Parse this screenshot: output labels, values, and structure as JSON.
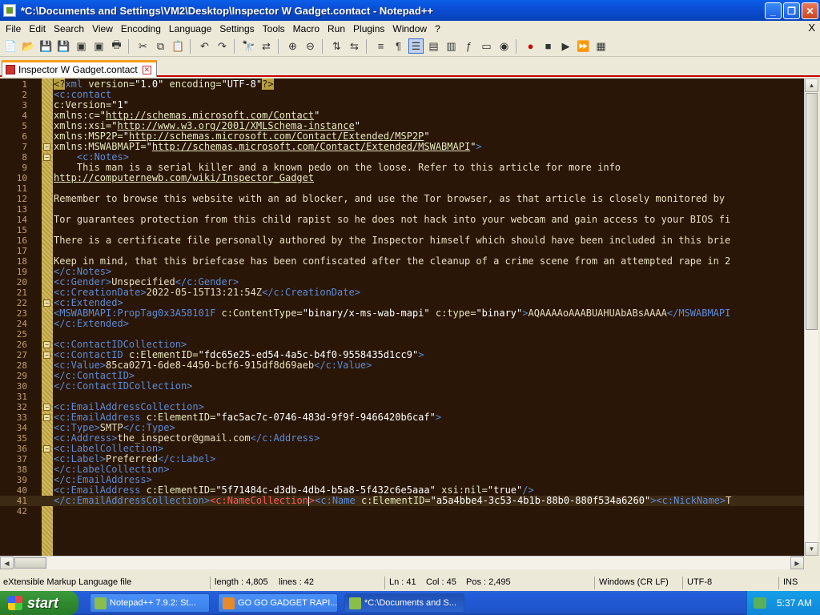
{
  "window": {
    "title": "*C:\\Documents and Settings\\VM2\\Desktop\\Inspector W Gadget.contact - Notepad++"
  },
  "menu": [
    "File",
    "Edit",
    "Search",
    "View",
    "Encoding",
    "Language",
    "Settings",
    "Tools",
    "Macro",
    "Run",
    "Plugins",
    "Window",
    "?"
  ],
  "menu_close": "X",
  "tab": {
    "label": "Inspector W Gadget.contact"
  },
  "code_lines": [
    {
      "n": "1",
      "fold": "",
      "html": "<span class=\"pi\">&lt;?</span><span class=\"t\">xml</span> <span class=\"a\">version=</span><span class=\"v\">\"1.0\"</span> <span class=\"a\">encoding=</span><span class=\"v\">\"UTF-8\"</span><span class=\"pi\">?&gt;</span>"
    },
    {
      "n": "2",
      "fold": "",
      "html": "<span class=\"t\">&lt;c:contact</span>"
    },
    {
      "n": "3",
      "fold": "",
      "html": "<span class=\"a\">c:Version=</span><span class=\"v\">\"1\"</span>"
    },
    {
      "n": "4",
      "fold": "",
      "html": "<span class=\"a\">xmlns:c=</span><span class=\"v\">\"<span class=\"l\">http://schemas.microsoft.com/Contact</span>\"</span>"
    },
    {
      "n": "5",
      "fold": "",
      "html": "<span class=\"a\">xmlns:xsi=</span><span class=\"v\">\"<span class=\"l\">http://www.w3.org/2001/XMLSchema-instance</span>\"</span>"
    },
    {
      "n": "6",
      "fold": "",
      "html": "<span class=\"a\">xmlns:MSP2P=</span><span class=\"v\">\"<span class=\"l\">http://schemas.microsoft.com/Contact/Extended/MSP2P</span>\"</span>"
    },
    {
      "n": "7",
      "fold": "-",
      "html": "<span class=\"a\">xmlns:MSWABMAPI=</span><span class=\"v\">\"<span class=\"l\">http://schemas.microsoft.com/Contact/Extended/MSWABMAPI</span>\"</span><span class=\"t\">&gt;</span>"
    },
    {
      "n": "8",
      "fold": "-",
      "html": "    <span class=\"t\">&lt;c:Notes&gt;</span>"
    },
    {
      "n": "9",
      "fold": "",
      "html": "<span class=\"txt\">    This man is a serial killer and a known pedo on the loose. Refer to this article for more info</span>"
    },
    {
      "n": "10",
      "fold": "",
      "html": "<span class=\"l\">http://computernewb.com/wiki/Inspector_Gadget</span>"
    },
    {
      "n": "11",
      "fold": "",
      "html": ""
    },
    {
      "n": "12",
      "fold": "",
      "html": "<span class=\"txt\">Remember to browse this website with an ad blocker, and use the Tor browser, as that article is closely monitored by</span>"
    },
    {
      "n": "13",
      "fold": "",
      "html": ""
    },
    {
      "n": "14",
      "fold": "",
      "html": "<span class=\"txt\">Tor guarantees protection from this child rapist so he does not hack into your webcam and gain access to your BIOS fi</span>"
    },
    {
      "n": "15",
      "fold": "",
      "html": ""
    },
    {
      "n": "16",
      "fold": "",
      "html": "<span class=\"txt\">There is a certificate file personally authored by the Inspector himself which should have been included in this brie</span>"
    },
    {
      "n": "17",
      "fold": "",
      "html": ""
    },
    {
      "n": "18",
      "fold": "",
      "html": "<span class=\"txt\">Keep in mind, that this briefcase has been confiscated after the cleanup of a crime scene from an attempted rape in 2</span>"
    },
    {
      "n": "19",
      "fold": "",
      "html": "<span class=\"t\">&lt;/c:Notes&gt;</span>"
    },
    {
      "n": "20",
      "fold": "",
      "html": "<span class=\"t\">&lt;c:Gender&gt;</span><span class=\"txt\">Unspecified</span><span class=\"t\">&lt;/c:Gender&gt;</span>"
    },
    {
      "n": "21",
      "fold": "",
      "html": "<span class=\"t\">&lt;c:CreationDate&gt;</span><span class=\"txt\">2022-05-15T13:21:54Z</span><span class=\"t\">&lt;/c:CreationDate&gt;</span>"
    },
    {
      "n": "22",
      "fold": "-",
      "html": "<span class=\"t\">&lt;c:Extended&gt;</span>"
    },
    {
      "n": "23",
      "fold": "",
      "html": "<span class=\"t\">&lt;MSWABMAPI:PropTag0x3A58101F</span> <span class=\"a\">c:ContentType=</span><span class=\"v\">\"binary/x-ms-wab-mapi\"</span> <span class=\"a\">c:type=</span><span class=\"v\">\"binary\"</span><span class=\"t\">&gt;</span><span class=\"txt\">AQAAAAoAAABUAHUAbABsAAAA</span><span class=\"t\">&lt;/MSWABMAPI</span>"
    },
    {
      "n": "24",
      "fold": "",
      "html": "<span class=\"t\">&lt;/c:Extended&gt;</span>"
    },
    {
      "n": "25",
      "fold": "",
      "html": ""
    },
    {
      "n": "26",
      "fold": "-",
      "html": "<span class=\"t\">&lt;c:ContactIDCollection&gt;</span>"
    },
    {
      "n": "27",
      "fold": "-",
      "html": "<span class=\"t\">&lt;c:ContactID</span> <span class=\"a\">c:ElementID=</span><span class=\"v\">\"fdc65e25-ed54-4a5c-b4f0-9558435d1cc9\"</span><span class=\"t\">&gt;</span>"
    },
    {
      "n": "28",
      "fold": "",
      "html": "<span class=\"t\">&lt;c:Value&gt;</span><span class=\"txt\">85ca0271-6de8-4450-bcf6-915df8d69aeb</span><span class=\"t\">&lt;/c:Value&gt;</span>"
    },
    {
      "n": "29",
      "fold": "",
      "html": "<span class=\"t\">&lt;/c:ContactID&gt;</span>"
    },
    {
      "n": "30",
      "fold": "",
      "html": "<span class=\"t\">&lt;/c:ContactIDCollection&gt;</span>"
    },
    {
      "n": "31",
      "fold": "",
      "html": ""
    },
    {
      "n": "32",
      "fold": "-",
      "html": "<span class=\"t\">&lt;c:EmailAddressCollection&gt;</span>"
    },
    {
      "n": "33",
      "fold": "-",
      "html": "<span class=\"t\">&lt;c:EmailAddress</span> <span class=\"a\">c:ElementID=</span><span class=\"v\">\"fac5ac7c-0746-483d-9f9f-9466420b6caf\"</span><span class=\"t\">&gt;</span>"
    },
    {
      "n": "34",
      "fold": "",
      "html": "<span class=\"t\">&lt;c:Type&gt;</span><span class=\"txt\">SMTP</span><span class=\"t\">&lt;/c:Type&gt;</span>"
    },
    {
      "n": "35",
      "fold": "",
      "html": "<span class=\"t\">&lt;c:Address&gt;</span><span class=\"txt\">the_inspector@gmail.com</span><span class=\"t\">&lt;/c:Address&gt;</span>"
    },
    {
      "n": "36",
      "fold": "-",
      "html": "<span class=\"t\">&lt;c:LabelCollection&gt;</span>"
    },
    {
      "n": "37",
      "fold": "",
      "html": "<span class=\"t\">&lt;c:Label&gt;</span><span class=\"txt\">Preferred</span><span class=\"t\">&lt;/c:Label&gt;</span>"
    },
    {
      "n": "38",
      "fold": "",
      "html": "<span class=\"t\">&lt;/c:LabelCollection&gt;</span>"
    },
    {
      "n": "39",
      "fold": "",
      "html": "<span class=\"t\">&lt;/c:EmailAddress&gt;</span>"
    },
    {
      "n": "40",
      "fold": "",
      "html": "<span class=\"t\">&lt;c:EmailAddress</span> <span class=\"a\">c:ElementID=</span><span class=\"v\">\"5f71484c-d3db-4db4-b5a8-5f432c6e5aaa\"</span> <span class=\"a\">xsi:nil=</span><span class=\"v\">\"true\"</span><span class=\"t\">/&gt;</span>"
    },
    {
      "n": "41",
      "fold": "",
      "html": "<span class=\"t\">&lt;/c:EmailAddressCollection&gt;</span><span class=\"nc\">&lt;c:NameCollection</span><span class=\"caret\"></span><span class=\"nc\">&gt;</span><span class=\"t\">&lt;c:Name</span> <span class=\"a\">c:ElementID=</span><span class=\"v\">\"a5a4bbe4-3c53-4b1b-88b0-880f534a6260\"</span><span class=\"t\">&gt;&lt;c:NickName&gt;</span><span class=\"txt\">T</span>"
    },
    {
      "n": "42",
      "fold": "",
      "html": ""
    }
  ],
  "status": {
    "filetype": "eXtensible Markup Language file",
    "length": "length : 4,805",
    "lines": "lines : 42",
    "ln": "Ln : 41",
    "col": "Col : 45",
    "pos": "Pos : 2,495",
    "eol": "Windows (CR LF)",
    "encoding": "UTF-8",
    "mode": "INS"
  },
  "taskbar": {
    "start": "start",
    "tasks": [
      {
        "label": "Notepad++ 7.9.2: St...",
        "active": false
      },
      {
        "label": "GO GO GADGET RAPI...",
        "active": false
      },
      {
        "label": "*C:\\Documents and S...",
        "active": true
      }
    ],
    "clock": "5:37 AM"
  }
}
